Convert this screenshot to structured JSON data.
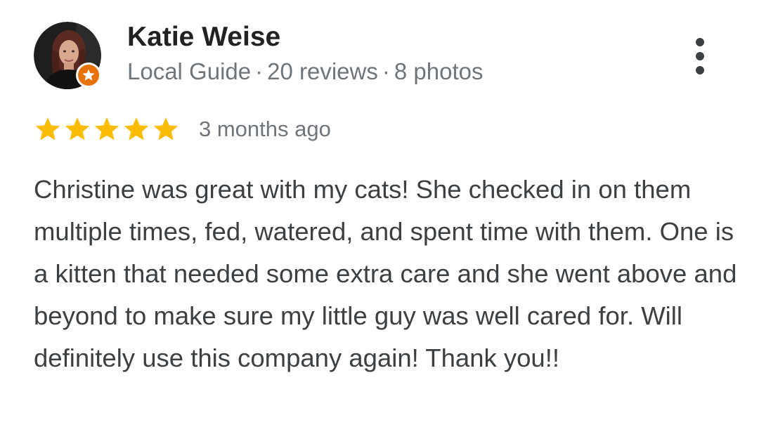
{
  "reviewer": {
    "name": "Katie Weise",
    "level": "Local Guide",
    "reviews_count": "20 reviews",
    "photos_count": "8 photos",
    "separator": "·"
  },
  "review": {
    "rating": 5,
    "max_rating": 5,
    "date": "3 months ago",
    "text": "Christine was great with my cats! She checked in on them multiple times, fed, watered, and spent time with them. One is a kitten that needed some extra care and she went above and beyond to make sure my little guy was well cared for. Will definitely use this company again! Thank you!!"
  },
  "icons": {
    "more": "more-vert-icon",
    "star": "star-icon",
    "badge": "local-guide-badge-icon"
  },
  "colors": {
    "star": "#fbbc04",
    "badge": "#e8710a",
    "name": "#222222",
    "meta": "#70757a",
    "body_text": "#3c4043"
  }
}
